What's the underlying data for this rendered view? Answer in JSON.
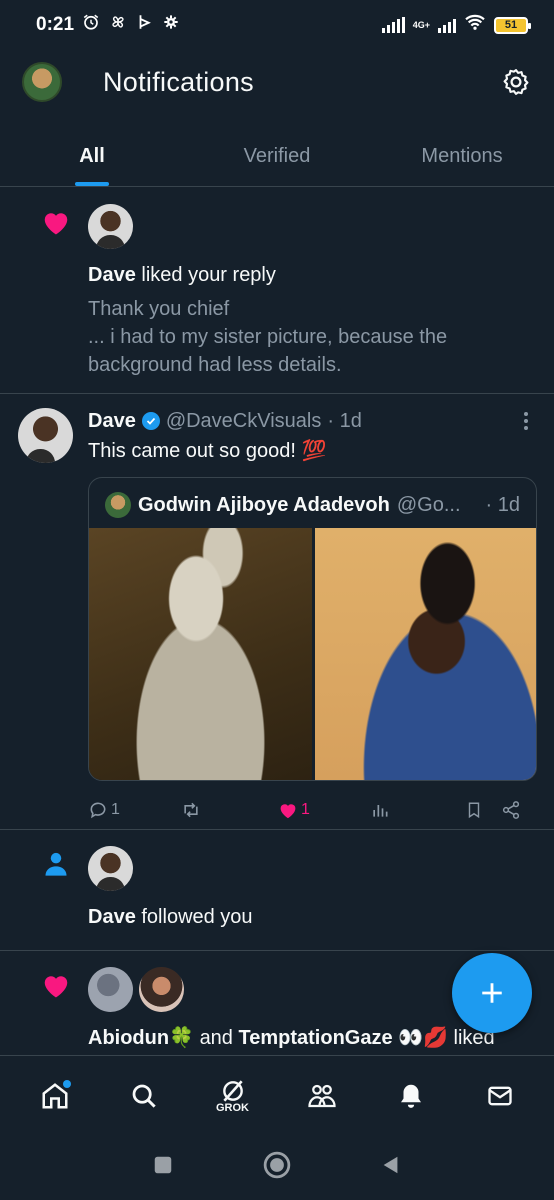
{
  "status_bar": {
    "time": "0:21",
    "network": "4G+",
    "battery": "51"
  },
  "header": {
    "title": "Notifications"
  },
  "tabs": [
    {
      "label": "All",
      "active": true
    },
    {
      "label": "Verified",
      "active": false
    },
    {
      "label": "Mentions",
      "active": false
    }
  ],
  "notifications": {
    "like_reply": {
      "actor": "Dave",
      "action": "liked your reply",
      "quote_line1": "Thank you chief",
      "quote_line2": "... i had to my sister picture, because the background had less details."
    },
    "tweet": {
      "name": "Dave",
      "handle": "@DaveCkVisuals",
      "time": "· 1d",
      "text": "This came out so good! 💯",
      "quoted": {
        "name": "Godwin Ajiboye Adadevoh",
        "handle": "@Go...",
        "time": "· 1d"
      },
      "replies": "1",
      "likes": "1"
    },
    "follow": {
      "actor": "Dave",
      "action": "followed you"
    },
    "like_multi": {
      "actor1": "Abiodun🍀",
      "connector": "and",
      "actor2": "TemptationGaze 👀💋",
      "action": "liked"
    }
  },
  "bottom_nav": {
    "grok_label": "GROK"
  },
  "colors": {
    "accent": "#1d9bf0",
    "like": "#f91880",
    "background": "#15202b"
  }
}
